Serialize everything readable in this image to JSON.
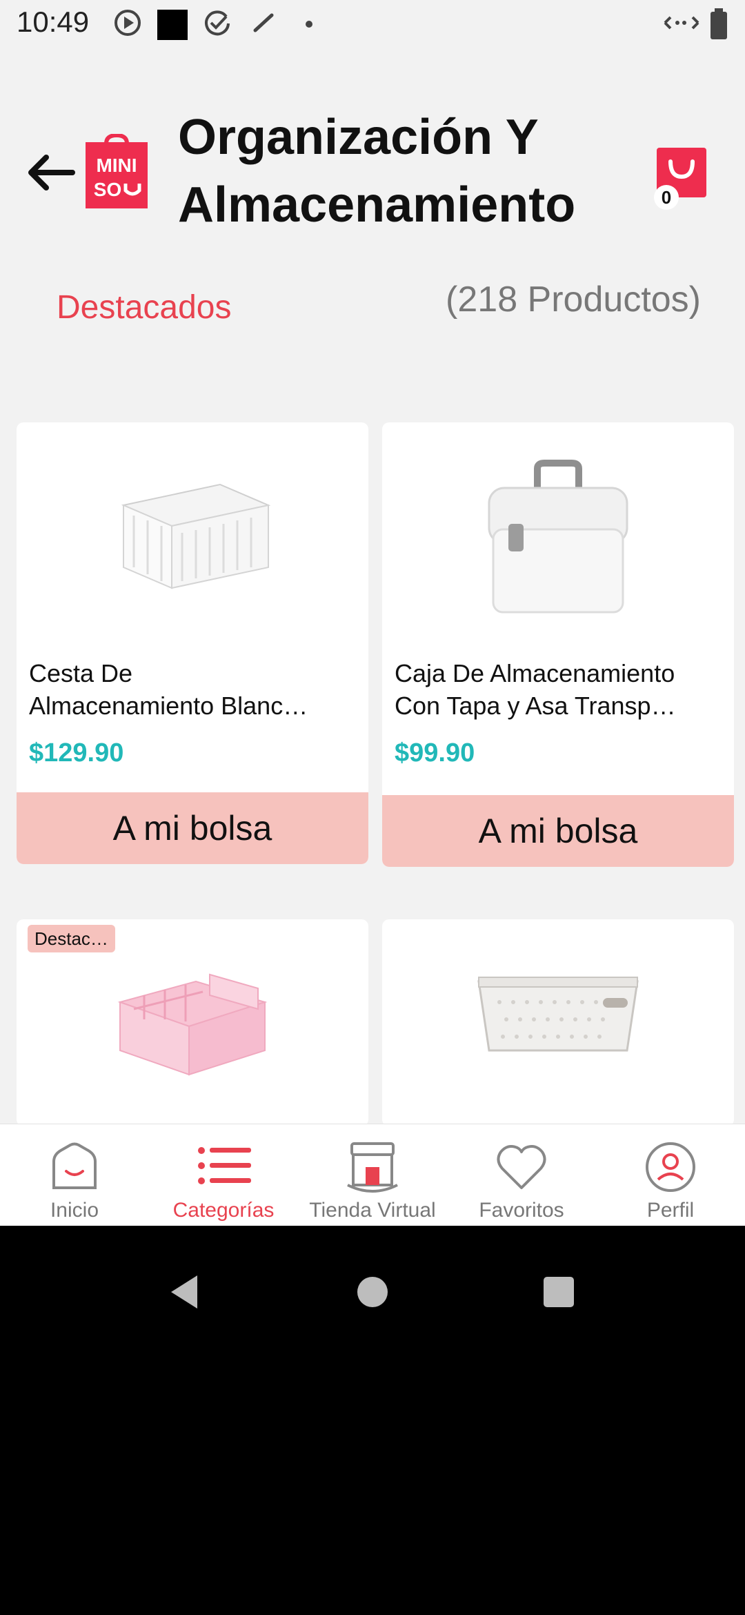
{
  "status_bar": {
    "time": "10:49"
  },
  "header": {
    "title": "Organización Y Almacenamiento",
    "logo_text_top": "MINI",
    "logo_text_bottom": "SO",
    "bag_count": "0"
  },
  "filter": {
    "sort_label": "Destacados",
    "product_count": "(218 Productos)"
  },
  "products": [
    {
      "name": "Cesta De\nAlmacenamiento   Blanc…",
      "price": "$129.90",
      "button": "A mi bolsa",
      "badge": ""
    },
    {
      "name": "Caja De Almacenamiento\nCon Tapa y Asa   Transp…",
      "price": "$99.90",
      "button": "A mi bolsa",
      "badge": ""
    },
    {
      "name": "",
      "price": "",
      "button": "",
      "badge": "Destac…"
    },
    {
      "name": "",
      "price": "",
      "button": "",
      "badge": ""
    }
  ],
  "bottom_nav": [
    {
      "label": "Inicio",
      "icon": "home-icon",
      "active": false
    },
    {
      "label": "Categorías",
      "icon": "list-icon",
      "active": true
    },
    {
      "label": "Tienda Virtual",
      "icon": "store-icon",
      "active": false
    },
    {
      "label": "Favoritos",
      "icon": "heart-icon",
      "active": false
    },
    {
      "label": "Perfil",
      "icon": "profile-icon",
      "active": false
    }
  ],
  "colors": {
    "accent": "#e8424f",
    "price": "#21b8b8",
    "button_bg": "#f6c2bd",
    "logo_bg": "#ee2d4e"
  }
}
